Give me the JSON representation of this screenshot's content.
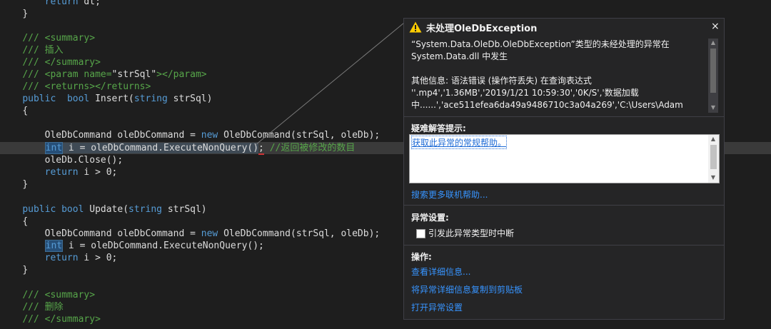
{
  "code": {
    "return_dt": "return dt;",
    "brace_close": "}",
    "brace_open": "{",
    "doc_prefix": "/// ",
    "summary_open": "<summary>",
    "summary_close": "</summary>",
    "insert_comment": "插入",
    "param_open": "<param name=",
    "param_value": "\"strSql\"",
    "param_close": "></param>",
    "returns_tags": "<returns></returns>",
    "kw_public": "public",
    "kw_bool": "bool",
    "kw_string": "string",
    "kw_int": "int",
    "kw_new": "new",
    "insert_sig_name": " Insert(",
    "update_sig_name": " Update(",
    "param_name": " strSql)",
    "cmd_decl": "OleDbCommand oleDbCommand = ",
    "cmd_ctor": " OleDbCommand(strSql, oleDb);",
    "exec_stmt": " i = oleDbCommand.ExecuteNonQuery()",
    "exec_stmt2": " i = oleDbCommand.ExecuteNonQuery();",
    "semicolon": ";",
    "exec_comment": " //返回被修改的数目",
    "close_stmt": "oleDb.Close();",
    "return_i": " i > 0;",
    "kw_return": "return",
    "delete_comment": "删除"
  },
  "popup": {
    "title": "未处理OleDbException",
    "close_glyph": "×",
    "message_lines": [
      "“System.Data.OleDb.OleDbException”类型的未经处理的异常在",
      "System.Data.dll 中发生",
      "",
      "其他信息: 语法错误 (操作符丢失) 在查询表达式",
      "''.mp4','1.36MB','2019/1/21 10:59:30','0K/S','数据加载",
      "中......','ace511efea6da49a9486710c3a04a269','C:\\Users\\Adam"
    ],
    "hints_label": "疑难解答提示:",
    "hint_link": "获取此异常的常规帮助。",
    "search_more": "搜索更多联机帮助...",
    "exception_settings_label": "异常设置:",
    "break_checkbox_label": "引发此异常类型时中断",
    "actions_label": "操作:",
    "action_view_details": "查看详细信息...",
    "action_copy_details": "将异常详细信息复制到剪贴板",
    "action_open_settings": "打开异常设置"
  },
  "colors": {
    "editor_bg": "#1e1e1e",
    "keyword": "#569cd6",
    "comment": "#57a64a",
    "warning": "#ffcc00",
    "link": "#3794ff"
  }
}
